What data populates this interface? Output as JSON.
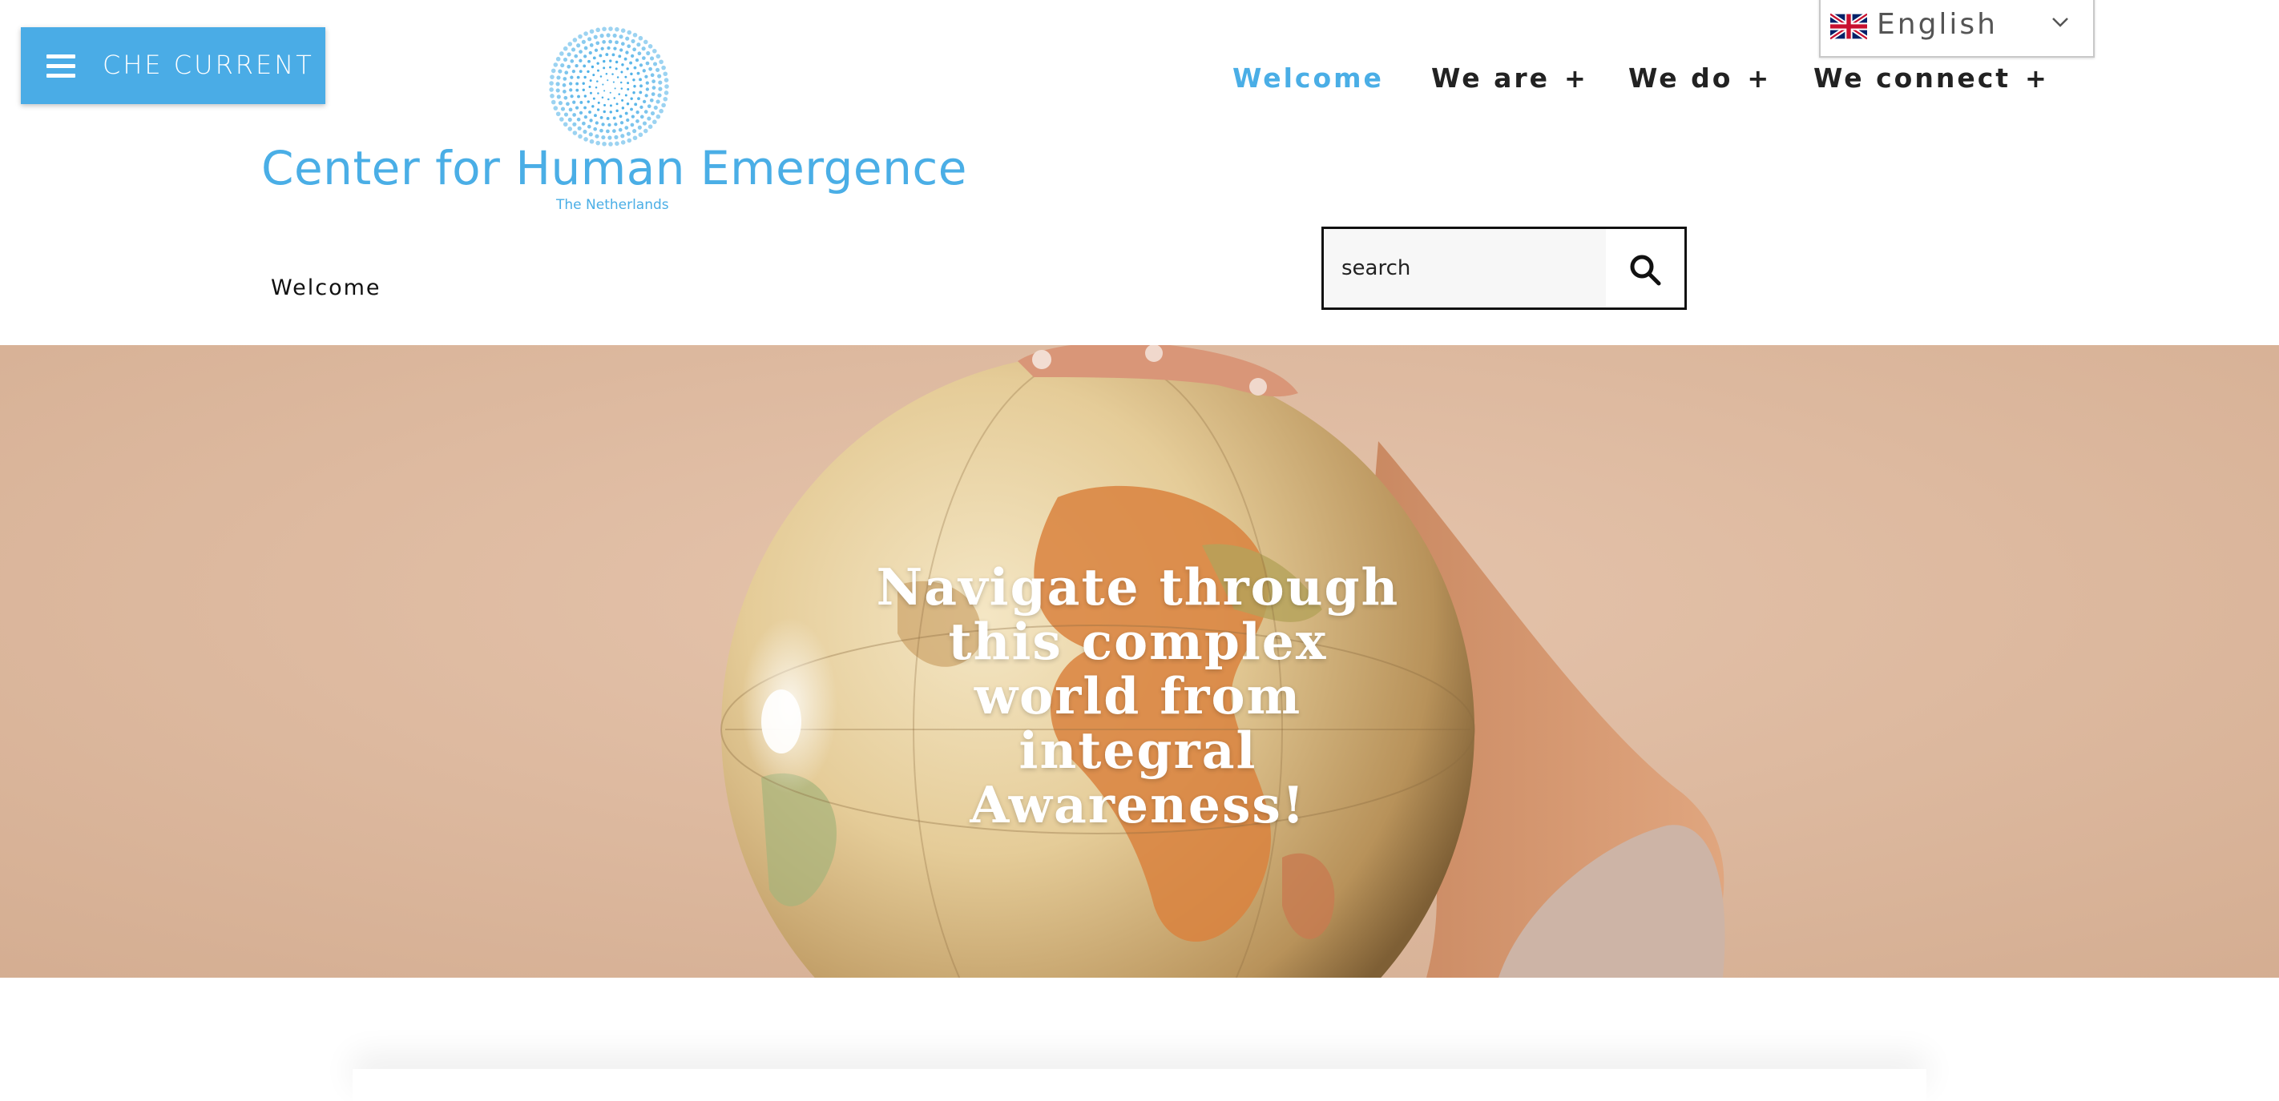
{
  "menu_button": {
    "label": "CHE CURRENT"
  },
  "logo": {
    "title": "Center for Human Emergence",
    "subtitle": "The Netherlands"
  },
  "language": {
    "selected": "English"
  },
  "nav": {
    "items": [
      {
        "label": "Welcome",
        "has_submenu": false,
        "active": true
      },
      {
        "label": "We are",
        "has_submenu": true,
        "active": false
      },
      {
        "label": "We do",
        "has_submenu": true,
        "active": false
      },
      {
        "label": "We connect",
        "has_submenu": true,
        "active": false
      }
    ],
    "submenu_symbol": "+"
  },
  "breadcrumb": {
    "current": "Welcome"
  },
  "search": {
    "placeholder": "search"
  },
  "hero": {
    "heading": "Navigate through this complex world from integral Awareness!"
  },
  "colors": {
    "accent": "#4aaee6",
    "menu_button": "#4aace6",
    "hero_background": "#dcb79c",
    "text_dark": "#222222"
  }
}
